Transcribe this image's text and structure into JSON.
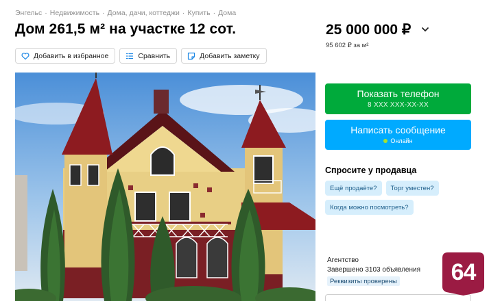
{
  "breadcrumb": [
    "Энгельс",
    "Недвижимость",
    "Дома, дачи, коттеджи",
    "Купить",
    "Дома"
  ],
  "breadcrumb_sep": "·",
  "title": "Дом 261,5 м² на участке 12 сот.",
  "price": "25 000 000 ₽",
  "price_per_sqm": "95 602 ₽ за м²",
  "actions": {
    "favorite": "Добавить в избранное",
    "compare": "Сравнить",
    "note": "Добавить заметку"
  },
  "contact": {
    "show_phone": "Показать телефон",
    "phone_mask": "8 XXX XXX-XX-XX",
    "write_message": "Написать сообщение",
    "online": "Онлайн"
  },
  "ask": {
    "title": "Спросите у продавца",
    "chips": [
      "Ещё продаёте?",
      "Торг уместен?",
      "Когда можно посмотреть?"
    ]
  },
  "seller": {
    "type": "Агентство",
    "completed": "Завершено 3103 объявления",
    "verified": "Реквизиты проверены"
  },
  "logo": {
    "text": "64",
    "color": "#9b1b43"
  },
  "colors": {
    "green": "#00aa3b",
    "blue": "#00aaff",
    "chip_bg": "#d6eefc"
  }
}
